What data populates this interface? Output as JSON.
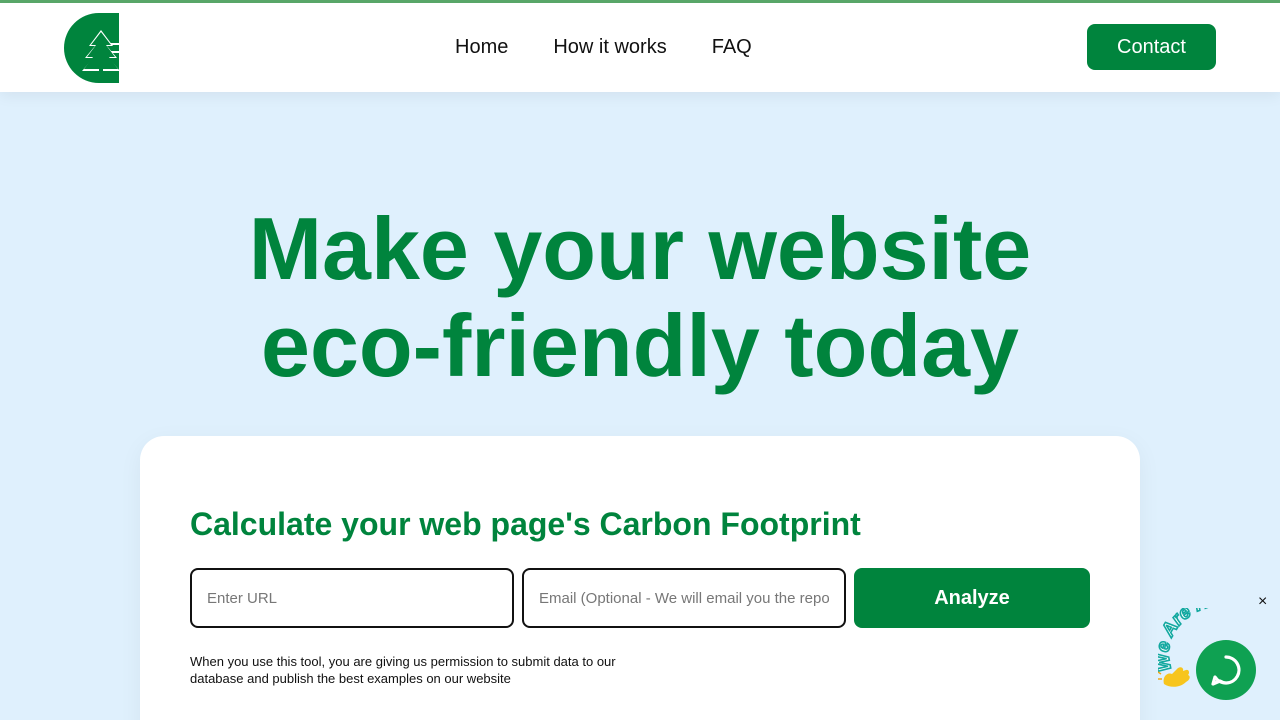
{
  "header": {
    "nav": [
      "Home",
      "How it works",
      "FAQ"
    ],
    "contact_label": "Contact"
  },
  "hero": {
    "title_line1": "Make your website",
    "title_line2": "eco-friendly today"
  },
  "calculator": {
    "title": "Calculate your web page's Carbon Footprint",
    "url_placeholder": "Enter URL",
    "email_placeholder": "Email (Optional - We will email you the report.)",
    "analyze_label": "Analyze",
    "disclaimer": "When you use this tool, you are giving us permission to submit data to our database and publish the best examples on our website"
  },
  "chat": {
    "close_glyph": "×",
    "label": "We Are Here!"
  },
  "colors": {
    "brand": "#00843d",
    "background": "#dff0fd",
    "accent_bar": "#5aa86a",
    "chat": "#0fa152"
  }
}
